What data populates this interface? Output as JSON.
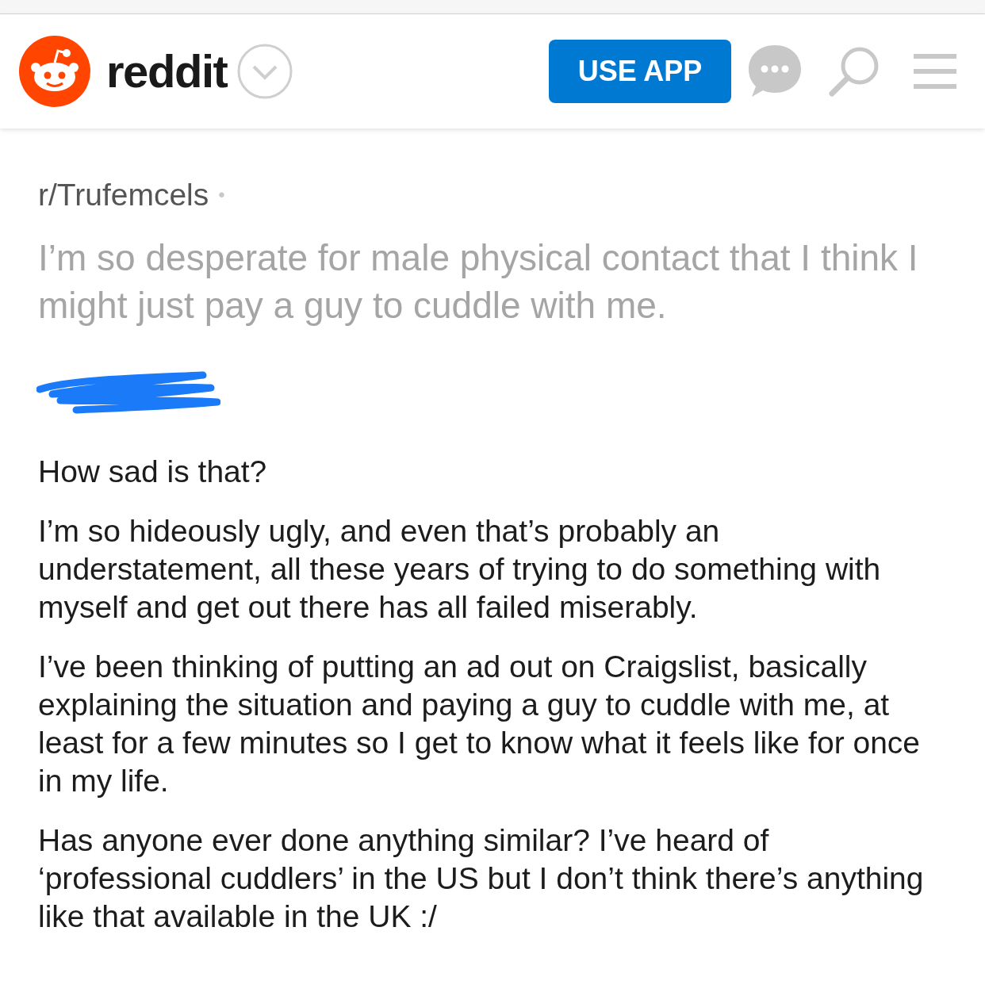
{
  "header": {
    "logo_text": "reddit",
    "button": "USE APP"
  },
  "post": {
    "subreddit": "r/Trufemcels",
    "separator": "•",
    "title": "I’m so desperate for male physical contact that I think I might just pay a guy to cuddle with me.",
    "paragraphs": [
      "How sad is that?",
      "I’m so hideously ugly, and even that’s probably an understatement, all these years of trying to do something with myself and get out there has all failed miserably.",
      "I’ve been thinking of putting an ad out on Craigslist, basically explaining the situation and paying a guy to cuddle with me, at least for a few minutes so I get to know what it feels like for once in my life.",
      "Has anyone ever done anything similar? I’ve heard of ‘professional cuddlers’ in the US but I don’t think there’s anything like that available in the UK :/"
    ]
  }
}
